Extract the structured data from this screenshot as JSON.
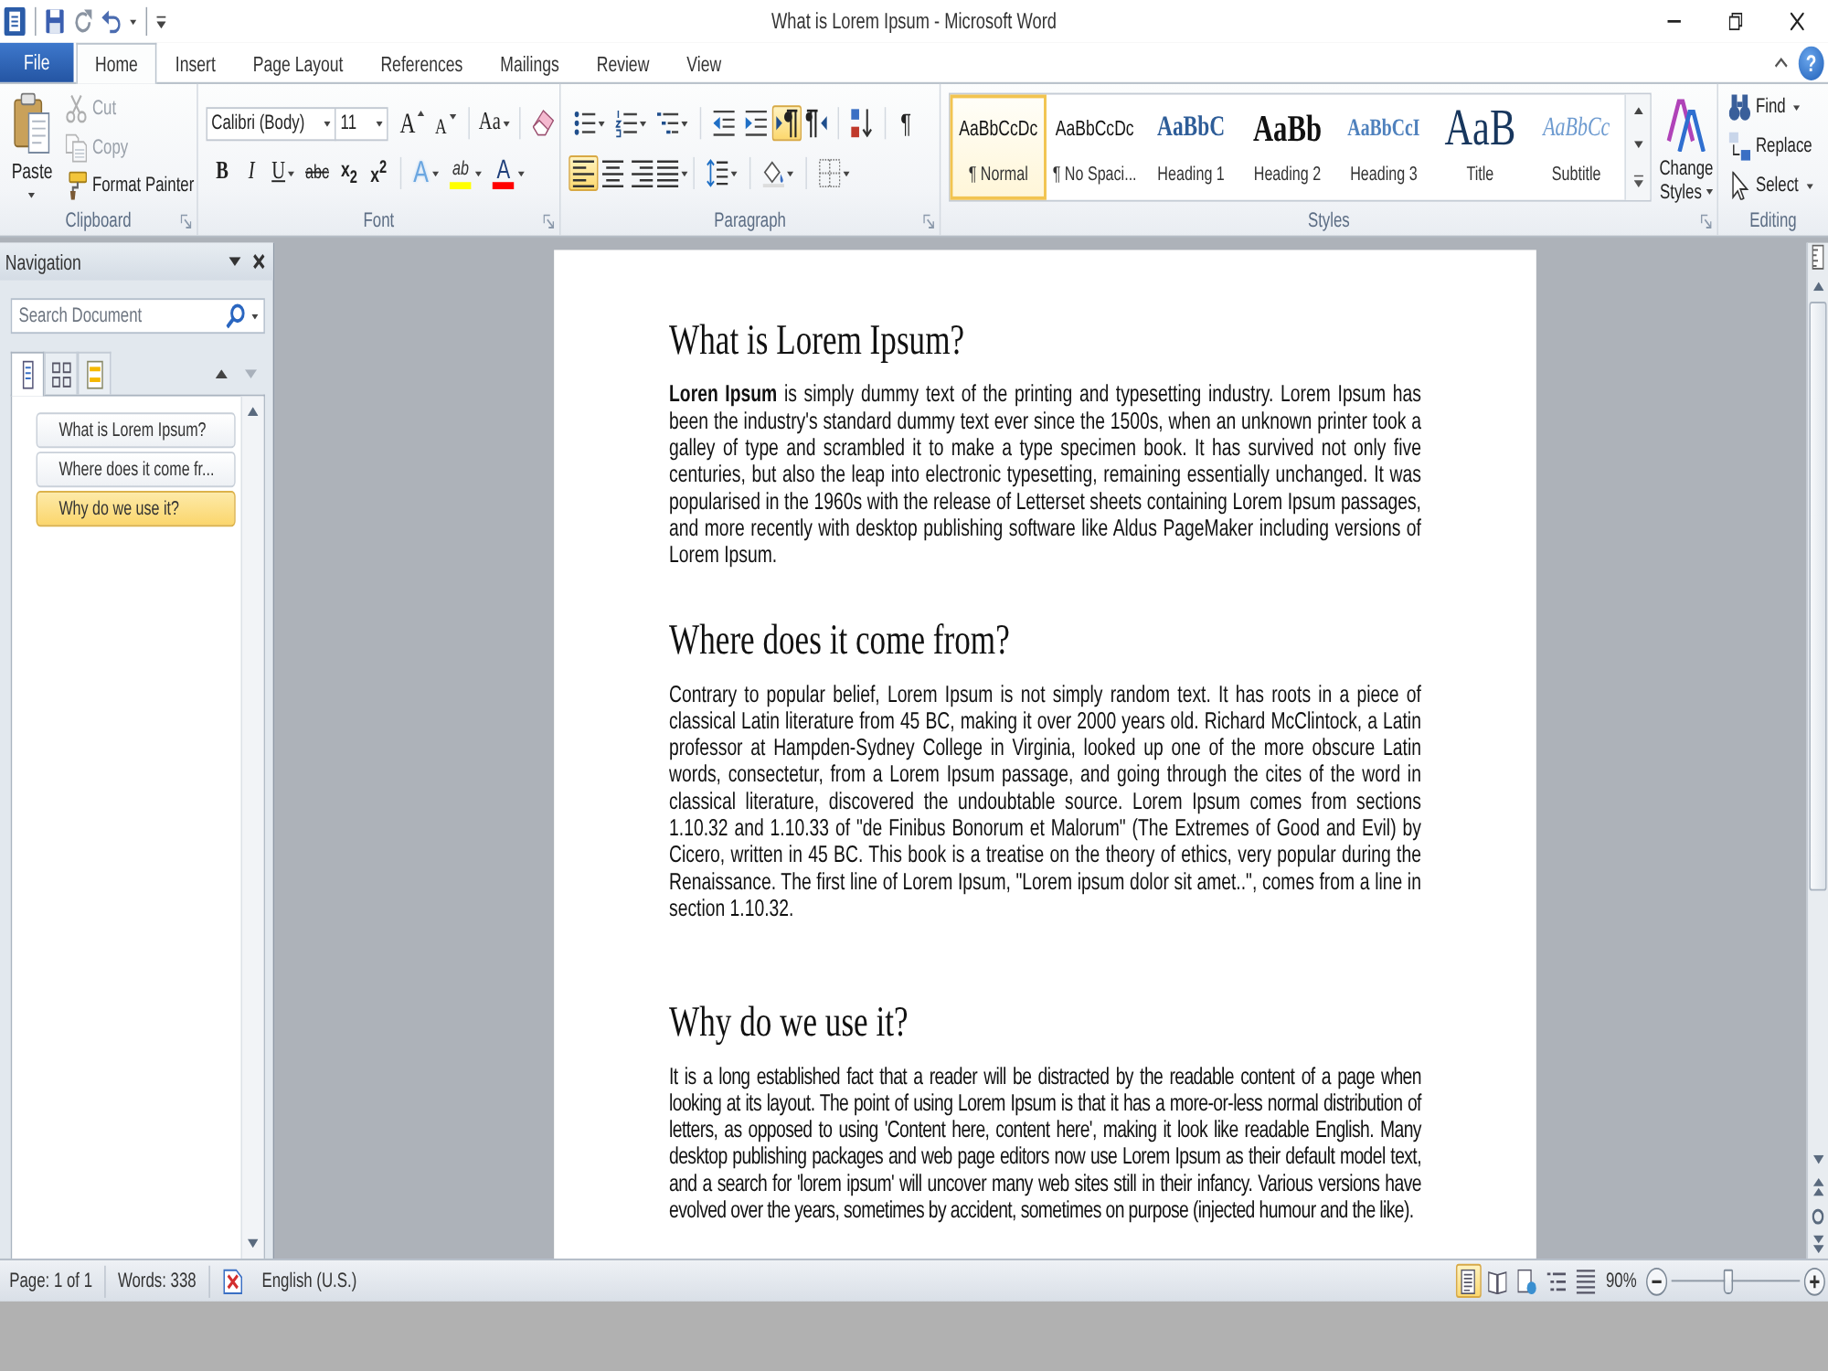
{
  "window": {
    "title": "What is Lorem Ipsum - Microsoft Word"
  },
  "ribbon_tabs": {
    "file": "File",
    "tabs": [
      {
        "label": "Home",
        "selected": true
      },
      {
        "label": "Insert",
        "selected": false
      },
      {
        "label": "Page Layout",
        "selected": false
      },
      {
        "label": "References",
        "selected": false
      },
      {
        "label": "Mailings",
        "selected": false
      },
      {
        "label": "Review",
        "selected": false
      },
      {
        "label": "View",
        "selected": false
      }
    ],
    "help": "?"
  },
  "clipboard": {
    "label": "Clipboard",
    "paste": "Paste",
    "commands": [
      {
        "label": "Cut",
        "disabled": true
      },
      {
        "label": "Copy",
        "disabled": true
      },
      {
        "label": "Format Painter",
        "disabled": false
      }
    ]
  },
  "font": {
    "label": "Font",
    "name": "Calibri (Body)",
    "size": "11",
    "size_buttons": [
      {
        "label": "A",
        "kind": "grow"
      },
      {
        "label": "A",
        "kind": "shrink"
      }
    ],
    "change_case": "Aa",
    "styles": [
      {
        "label": "B",
        "kind": "bold",
        "dropdown": false
      },
      {
        "label": "I",
        "kind": "italic",
        "dropdown": false
      },
      {
        "label": "U",
        "kind": "underline",
        "dropdown": true
      },
      {
        "label": "abc",
        "kind": "strike",
        "dropdown": false
      },
      {
        "label": "x$_{2}$",
        "kind": "subscript",
        "dropdown": false
      },
      {
        "label": "x$^{2}$",
        "kind": "superscript",
        "dropdown": false
      }
    ],
    "colors": [
      {
        "label": "A",
        "kind": "effects"
      },
      {
        "label": "ab",
        "kind": "highlight",
        "color": "#ffff00"
      },
      {
        "label": "A",
        "kind": "font_color",
        "color": "#ff0000"
      }
    ]
  },
  "paragraph": {
    "label": "Paragraph",
    "direction": [
      {
        "selected": true
      },
      {
        "selected": false
      }
    ],
    "show_marks": "¶",
    "alignment": [
      {
        "selected": true
      },
      {
        "selected": false
      },
      {
        "selected": false
      },
      {
        "selected": false
      }
    ]
  },
  "styles": {
    "label": "Styles",
    "gallery": [
      {
        "preview": "AaBbCcDc",
        "name": "¶ Normal",
        "kind": "normal",
        "selected": true
      },
      {
        "preview": "AaBbCcDc",
        "name": "¶ No Spaci...",
        "kind": "no_spacing",
        "selected": false
      },
      {
        "preview": "AaBbC",
        "name": "Heading 1",
        "kind": "heading1",
        "selected": false
      },
      {
        "preview": "AaBb",
        "name": "Heading 2",
        "kind": "heading2",
        "selected": false
      },
      {
        "preview": "AaBbCcI",
        "name": "Heading 3",
        "kind": "heading3",
        "selected": false
      },
      {
        "preview": "AaB",
        "name": "Title",
        "kind": "title",
        "selected": false
      },
      {
        "preview": "AaBbCc",
        "name": "Subtitle",
        "kind": "subtitle",
        "selected": false
      }
    ],
    "change_styles": "Change Styles"
  },
  "editing": {
    "label": "Editing",
    "commands": [
      {
        "label": "Find",
        "dropdown": true
      },
      {
        "label": "Replace",
        "dropdown": false
      },
      {
        "label": "Select",
        "dropdown": true
      }
    ]
  },
  "navigation": {
    "title": "Navigation",
    "search": {
      "placeholder": "Search Document"
    },
    "view_tabs": [
      {
        "selected": true
      },
      {
        "selected": false
      },
      {
        "selected": false
      }
    ],
    "headings": [
      {
        "label": "What is Lorem Ipsum?",
        "selected": false
      },
      {
        "label": "Where does it come fr...",
        "selected": false
      },
      {
        "label": "Why do we use it?",
        "selected": true
      }
    ]
  },
  "document": {
    "sections": [
      {
        "heading": "What is Lorem Ipsum?",
        "body": "**Loren Ipsum** is simply dummy text of the printing and typesetting industry. Lorem Ipsum has been the industry's standard dummy text ever since the 1500s, when an unknown printer took a galley of type and scrambled it to make a type specimen book. It has survived not only five centuries, but also the leap into electronic typesetting, remaining essentially unchanged. It was popularised in the 1960s with the release of Letterset sheets containing Lorem Ipsum passages, and more recently with desktop publishing software like Aldus PageMaker including versions of Lorem Ipsum.",
        "condensed": false
      },
      {
        "heading": "Where does it come from?",
        "body": "Contrary to popular belief, Lorem Ipsum is not simply random text. It has roots in a piece of classical Latin literature from 45 BC, making it over 2000 years old. Richard McClintock, a Latin professor at Hampden-Sydney College in Virginia, looked up one of the more obscure Latin words, consectetur, from a Lorem Ipsum passage, and going through the cites of the word in classical literature, discovered the undoubtable source. Lorem Ipsum comes from sections 1.10.32 and 1.10.33 of \"de Finibus Bonorum et Malorum\" (The Extremes of Good and Evil) by Cicero, written in 45 BC. This book is a treatise on the theory of ethics, very popular during the Renaissance. The first line of Lorem Ipsum, \"Lorem ipsum dolor sit amet..\", comes from a line in section 1.10.32.",
        "condensed": false
      },
      {
        "heading": "Why do we use it?",
        "body": "It is a long established fact that a reader will be distracted by the readable content of a page when looking at its layout. The point of using Lorem Ipsum is that it has a more-or-less normal distribution of letters, as opposed to using 'Content here, content here', making it look like readable English. Many desktop publishing packages and web page editors now use Lorem Ipsum as their default model text, and a search for 'lorem ipsum' will uncover many web sites still in their infancy. Various versions have evolved over the years, sometimes by accident, sometimes on purpose (injected humour and the like).",
        "condensed": true
      }
    ]
  },
  "status_bar": {
    "page": "Page: 1 of 1",
    "words": "Words: 338",
    "language": "English (U.S.)",
    "views": [
      {
        "selected": true
      },
      {
        "selected": false
      },
      {
        "selected": false
      },
      {
        "selected": false
      },
      {
        "selected": false
      }
    ],
    "zoom": {
      "reading": "90%",
      "level": 0.44
    }
  }
}
